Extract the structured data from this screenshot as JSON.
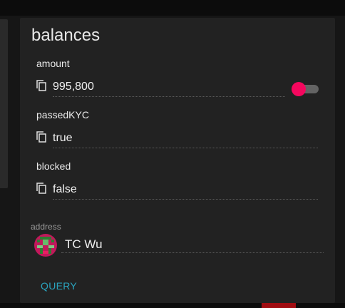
{
  "card": {
    "title": "balances",
    "fields": [
      {
        "label": "amount",
        "value": "995,800",
        "icon": "copy-icon"
      },
      {
        "label": "passedKYC",
        "value": "true",
        "icon": "copy-icon"
      },
      {
        "label": "blocked",
        "value": "false",
        "icon": "copy-icon"
      }
    ],
    "toggle": {
      "on": true,
      "color": "#f5075e"
    },
    "address": {
      "label": "address",
      "value": "TC Wu",
      "avatar": "identicon-avatar"
    },
    "query_label": "QUERY"
  },
  "colors": {
    "background": "#161616",
    "card": "#222222",
    "accent_link": "#2aa3bd",
    "toggle_on": "#f5075e",
    "status_badge": "#a00d12"
  }
}
